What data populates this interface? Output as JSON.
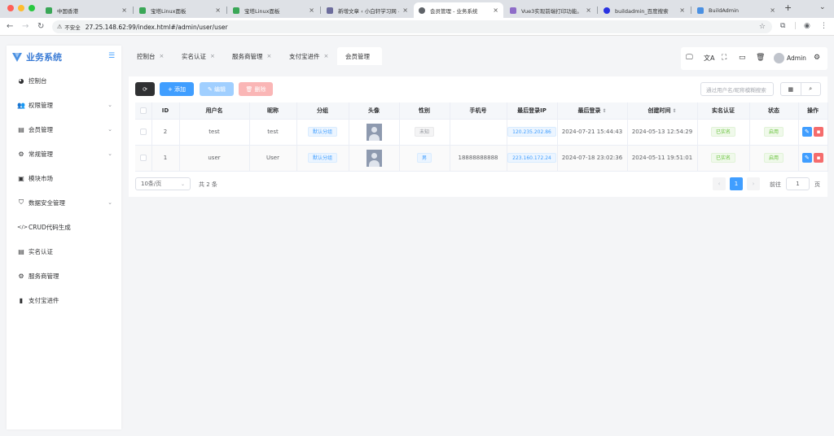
{
  "browser": {
    "tabs": [
      {
        "title": "中国香港",
        "favicon_color": "#3aa757"
      },
      {
        "title": "宝塔Linux面板",
        "favicon_color": "#3aa757"
      },
      {
        "title": "宝塔Linux面板",
        "favicon_color": "#3aa757"
      },
      {
        "title": "新增文章 ‹ 小白轩学习网 — WordPress",
        "favicon_color": "#6c6c9c"
      },
      {
        "title": "会员管理 - 业务系统",
        "favicon_color": "#5f6368"
      },
      {
        "title": "Vue3实现前端打印功能。",
        "favicon_color": "#8e6cc8"
      },
      {
        "title": "buildadmin_百度搜索",
        "favicon_color": "#2932e1"
      },
      {
        "title": "BuildAdmin",
        "favicon_color": "#4a90e2"
      }
    ],
    "new_tab": "+",
    "address": {
      "security": "不安全",
      "url": "27.25.148.62:99/index.html#/admin/user/user"
    }
  },
  "sidebar": {
    "brand": "业务系统",
    "items": [
      {
        "label": "控制台",
        "icon": "dashboard-icon",
        "glyph": "◕",
        "arrow": ""
      },
      {
        "label": "权限管理",
        "icon": "users-icon",
        "glyph": "👥",
        "arrow": "⌄"
      },
      {
        "label": "会员管理",
        "icon": "id-card-icon",
        "glyph": "▤",
        "arrow": "⌄"
      },
      {
        "label": "常规管理",
        "icon": "gears-icon",
        "glyph": "⚙",
        "arrow": "⌄"
      },
      {
        "label": "模块市场",
        "icon": "shopping-bag-icon",
        "glyph": "▣",
        "arrow": ""
      },
      {
        "label": "数据安全管理",
        "icon": "shield-icon",
        "glyph": "⛉",
        "arrow": "⌄"
      },
      {
        "label": "CRUD代码生成",
        "icon": "code-icon",
        "glyph": "</>",
        "arrow": ""
      },
      {
        "label": "实名认证",
        "icon": "id-card-icon",
        "glyph": "▤",
        "arrow": ""
      },
      {
        "label": "服务商管理",
        "icon": "gear-icon",
        "glyph": "⚙",
        "arrow": ""
      },
      {
        "label": "支付宝进件",
        "icon": "bar-chart-icon",
        "glyph": "▮",
        "arrow": ""
      }
    ]
  },
  "nav_tabs": [
    {
      "label": "控制台",
      "close": "×"
    },
    {
      "label": "实名认证",
      "close": "×"
    },
    {
      "label": "服务商管理",
      "close": "×"
    },
    {
      "label": "支付宝进件",
      "close": "×"
    },
    {
      "label": "会员管理",
      "close": ""
    }
  ],
  "header": {
    "username": "Admin"
  },
  "toolbar": {
    "refresh": "⟳",
    "add": "+ 添加",
    "edit": "✎ 编辑",
    "delete": "🗑 删除",
    "search_placeholder": "通过用户名/昵称模糊搜索"
  },
  "table": {
    "columns": [
      "",
      "ID",
      "用户名",
      "昵称",
      "分组",
      "头像",
      "性别",
      "手机号",
      "最后登录IP",
      "最后登录",
      "创建时间",
      "实名认证",
      "状态",
      "操作"
    ],
    "sort_icon": "⇕",
    "rows": [
      {
        "id": "2",
        "username": "test",
        "nickname": "test",
        "group": "默认分组",
        "gender": "未知",
        "mobile": "",
        "ip": "120.235.202.86",
        "last_login": "2024-07-21 15:44:43",
        "created": "2024-05-13 12:54:29",
        "verified": "已实名",
        "status": "启用"
      },
      {
        "id": "1",
        "username": "user",
        "nickname": "User",
        "group": "默认分组",
        "gender": "男",
        "mobile": "18888888888",
        "ip": "223.160.172.24",
        "last_login": "2024-07-18 23:02:36",
        "created": "2024-05-11 19:51:01",
        "verified": "已实名",
        "status": "启用"
      }
    ]
  },
  "pagination": {
    "page_size": "10条/页",
    "total": "共 2 条",
    "prev": "‹",
    "current": "1",
    "next": "›",
    "goto_label": "前往",
    "goto_value": "1",
    "page_unit": "页"
  },
  "colors": {
    "primary": "#409eff",
    "danger": "#f56c6c",
    "success": "#67c23a",
    "dark": "#303133",
    "brand": "#3a7bd5"
  }
}
